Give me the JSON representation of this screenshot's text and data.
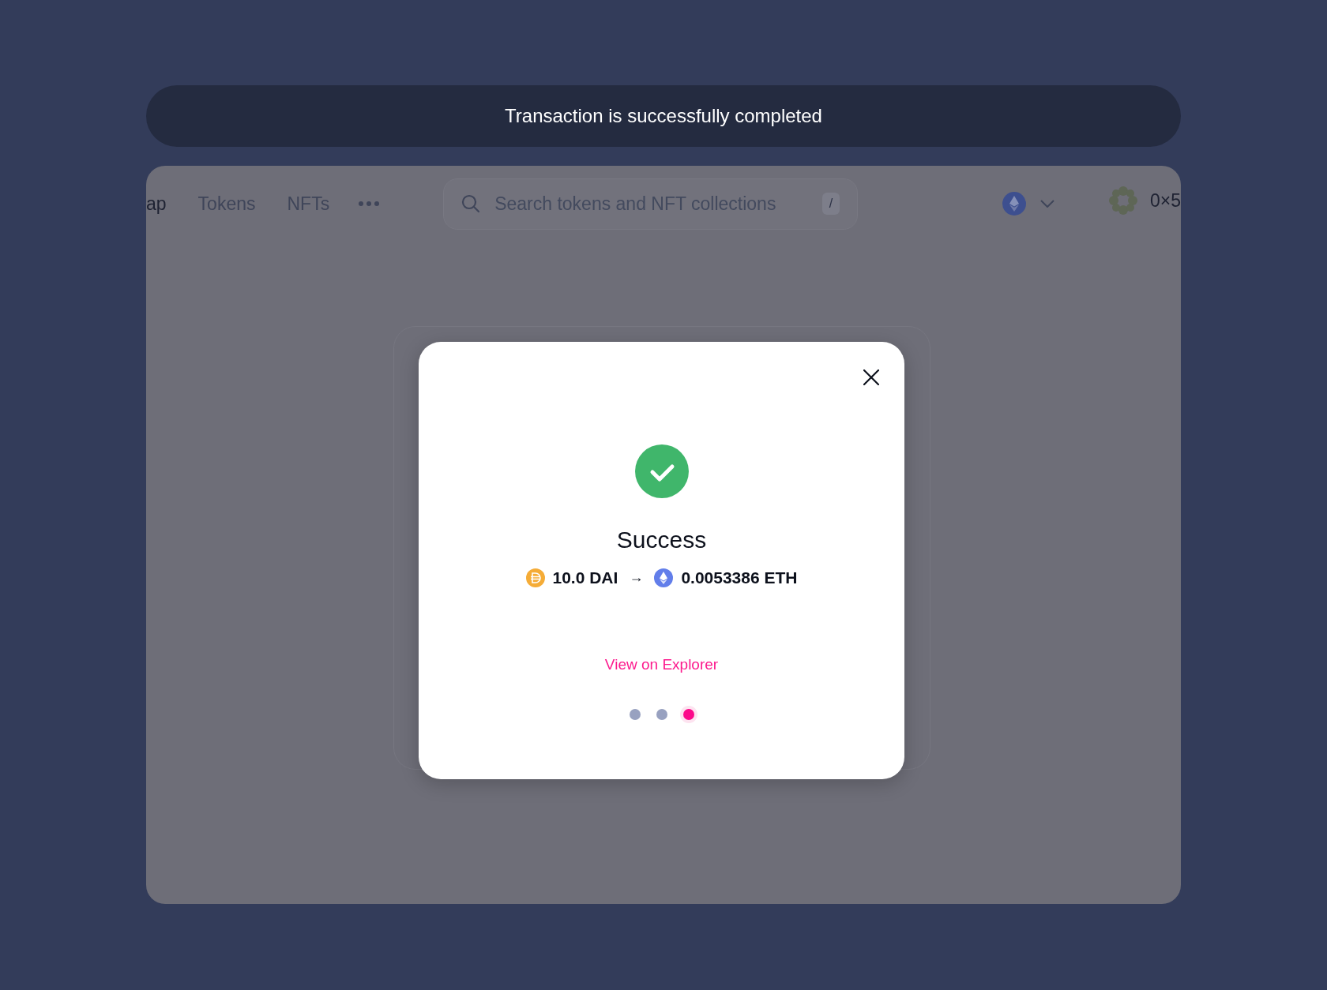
{
  "toast": {
    "message": "Transaction is successfully completed"
  },
  "nav": {
    "links": [
      {
        "label": "ap",
        "selected": true
      },
      {
        "label": "Tokens",
        "selected": false
      },
      {
        "label": "NFTs",
        "selected": false
      }
    ],
    "search": {
      "placeholder": "Search tokens and NFT collections",
      "shortcut": "/"
    },
    "wallet": {
      "address": "0×5"
    }
  },
  "modal": {
    "title": "Success",
    "from": {
      "amount": "10.0 DAI",
      "color": "#f5ac37"
    },
    "arrow": "→",
    "to": {
      "amount": "0.0053386 ETH",
      "color": "#627eea"
    },
    "link": "View on Explorer",
    "steps": [
      {
        "selected": false
      },
      {
        "selected": false
      },
      {
        "selected": true
      }
    ]
  }
}
